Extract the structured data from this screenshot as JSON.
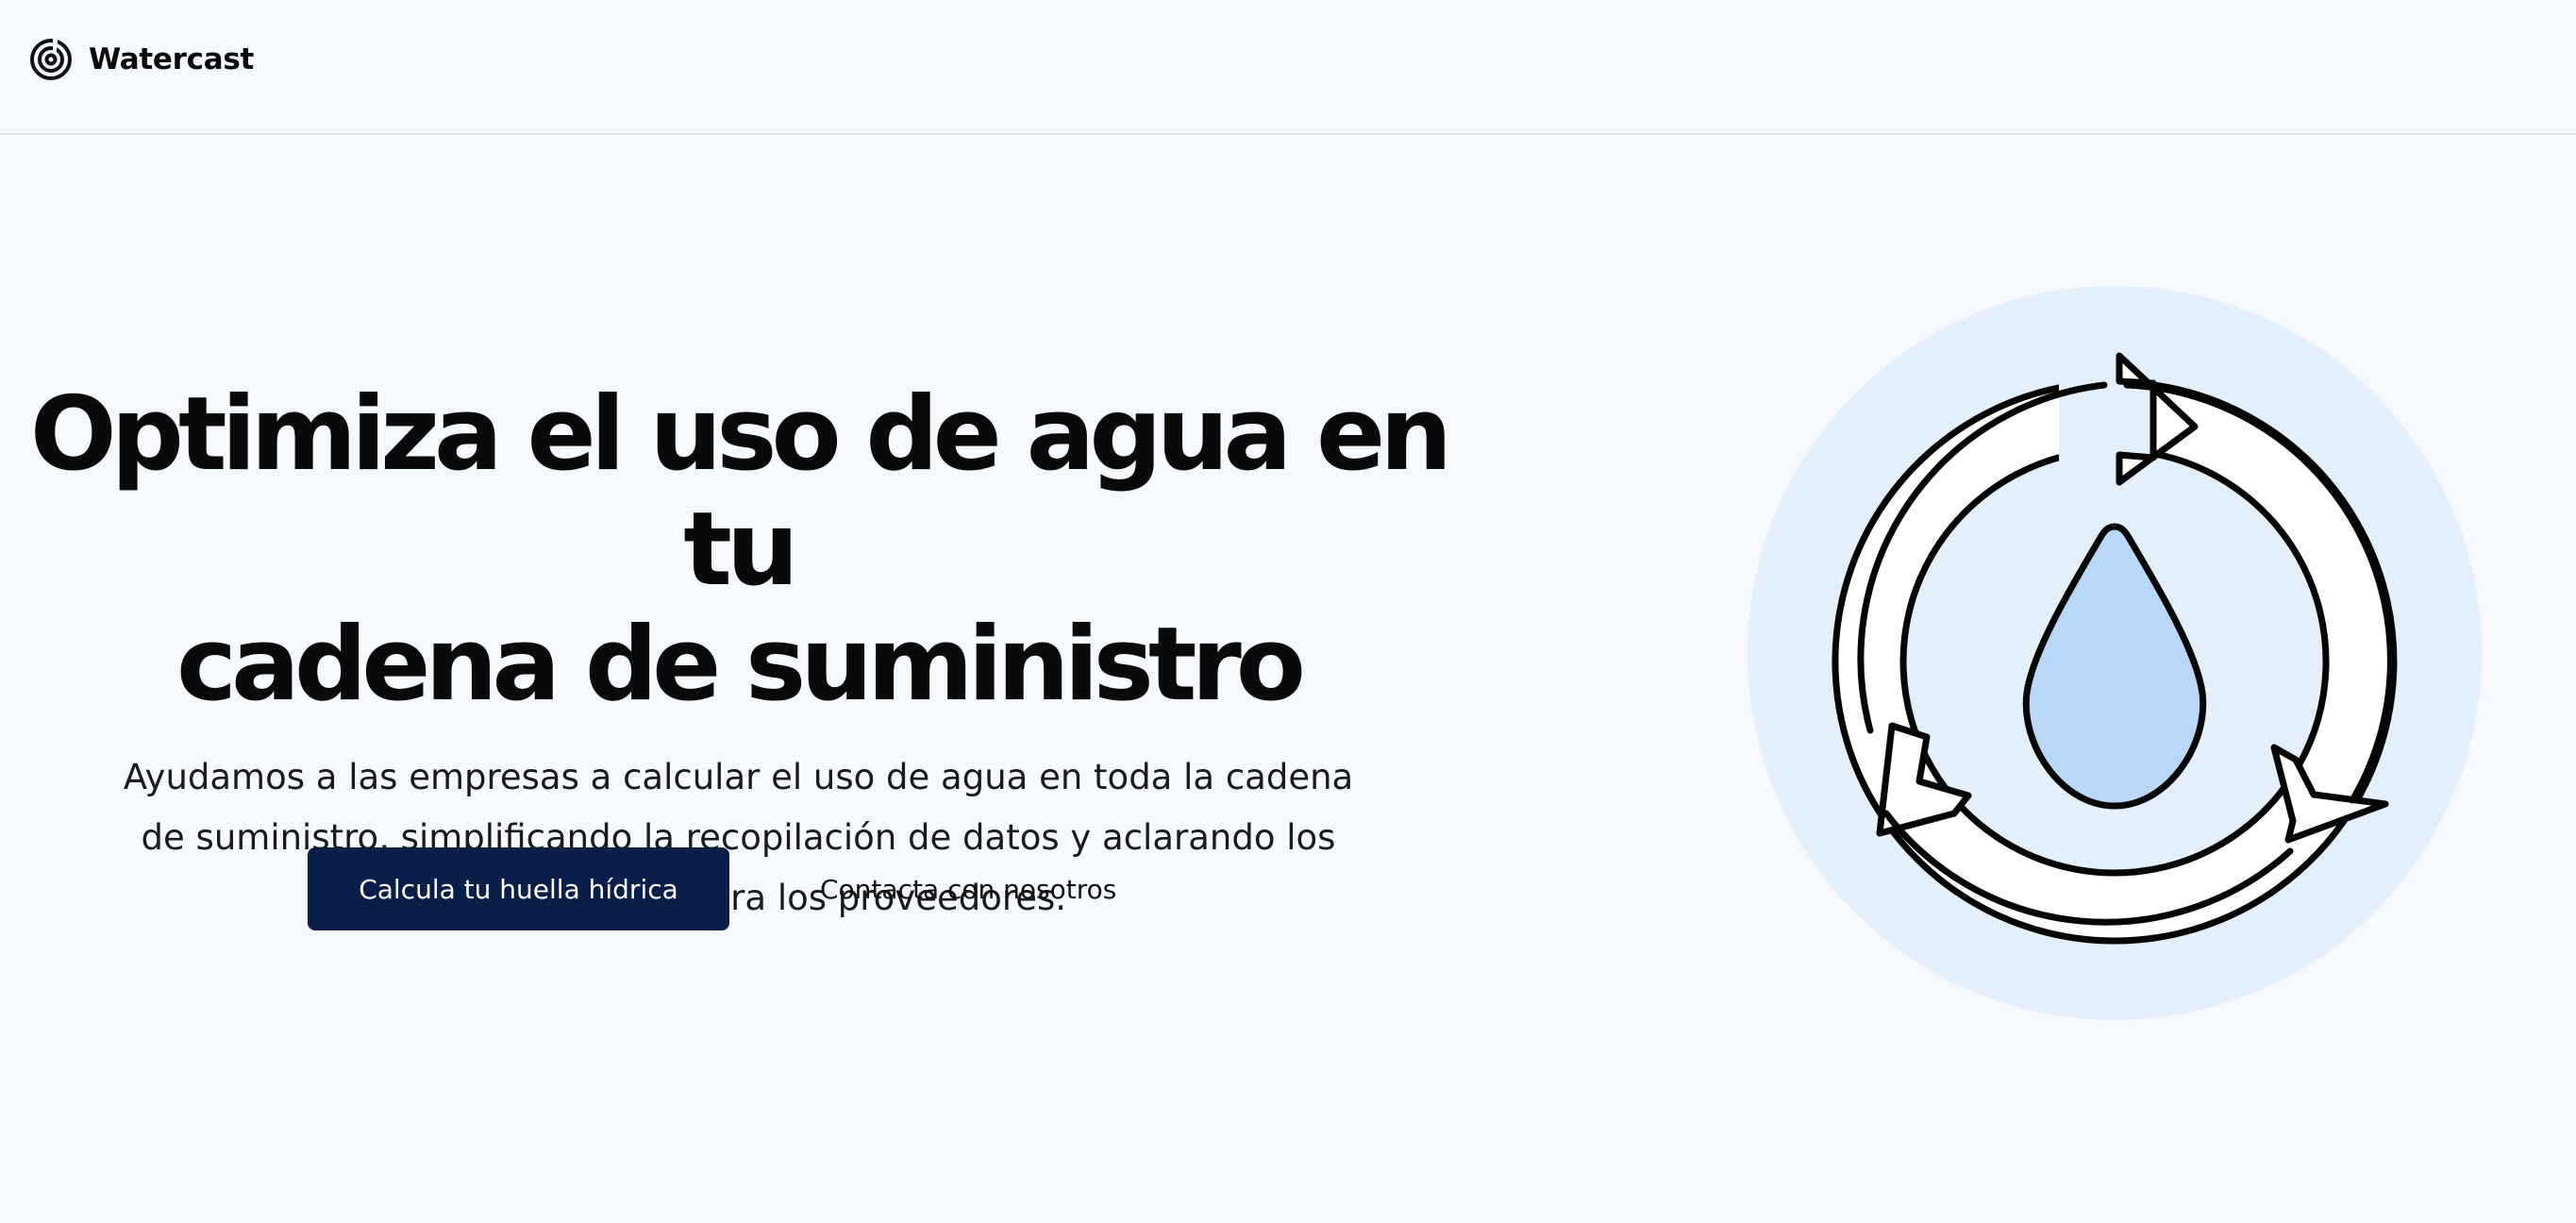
{
  "brand": {
    "name": "Watercast",
    "icon": "spiral-logo-icon"
  },
  "hero": {
    "headline_line1": "Optimiza el uso de agua en tu",
    "headline_line2": "cadena de suministro",
    "subtitle_line1": "Ayudamos a las empresas a calcular el uso de agua en toda la cadena",
    "subtitle_line2": "de suministro, simplificando la recopilación de datos y aclarando los",
    "subtitle_line3": "requerimientos para los proveedores.",
    "primary_cta": "Calcula tu huella hídrica",
    "secondary_cta": "Contacta con nosotros"
  },
  "illustration": {
    "name": "water-drop-recycle-illustration",
    "circle_color": "#e4effc",
    "drop_color": "#b9d7f8",
    "arrow_color": "#ffffff",
    "outline_color": "#050505"
  },
  "colors": {
    "background": "#f5f9fe",
    "primary_button": "#0a1e4a",
    "primary_button_text": "#ffffff",
    "divider": "#e3e7ec"
  }
}
